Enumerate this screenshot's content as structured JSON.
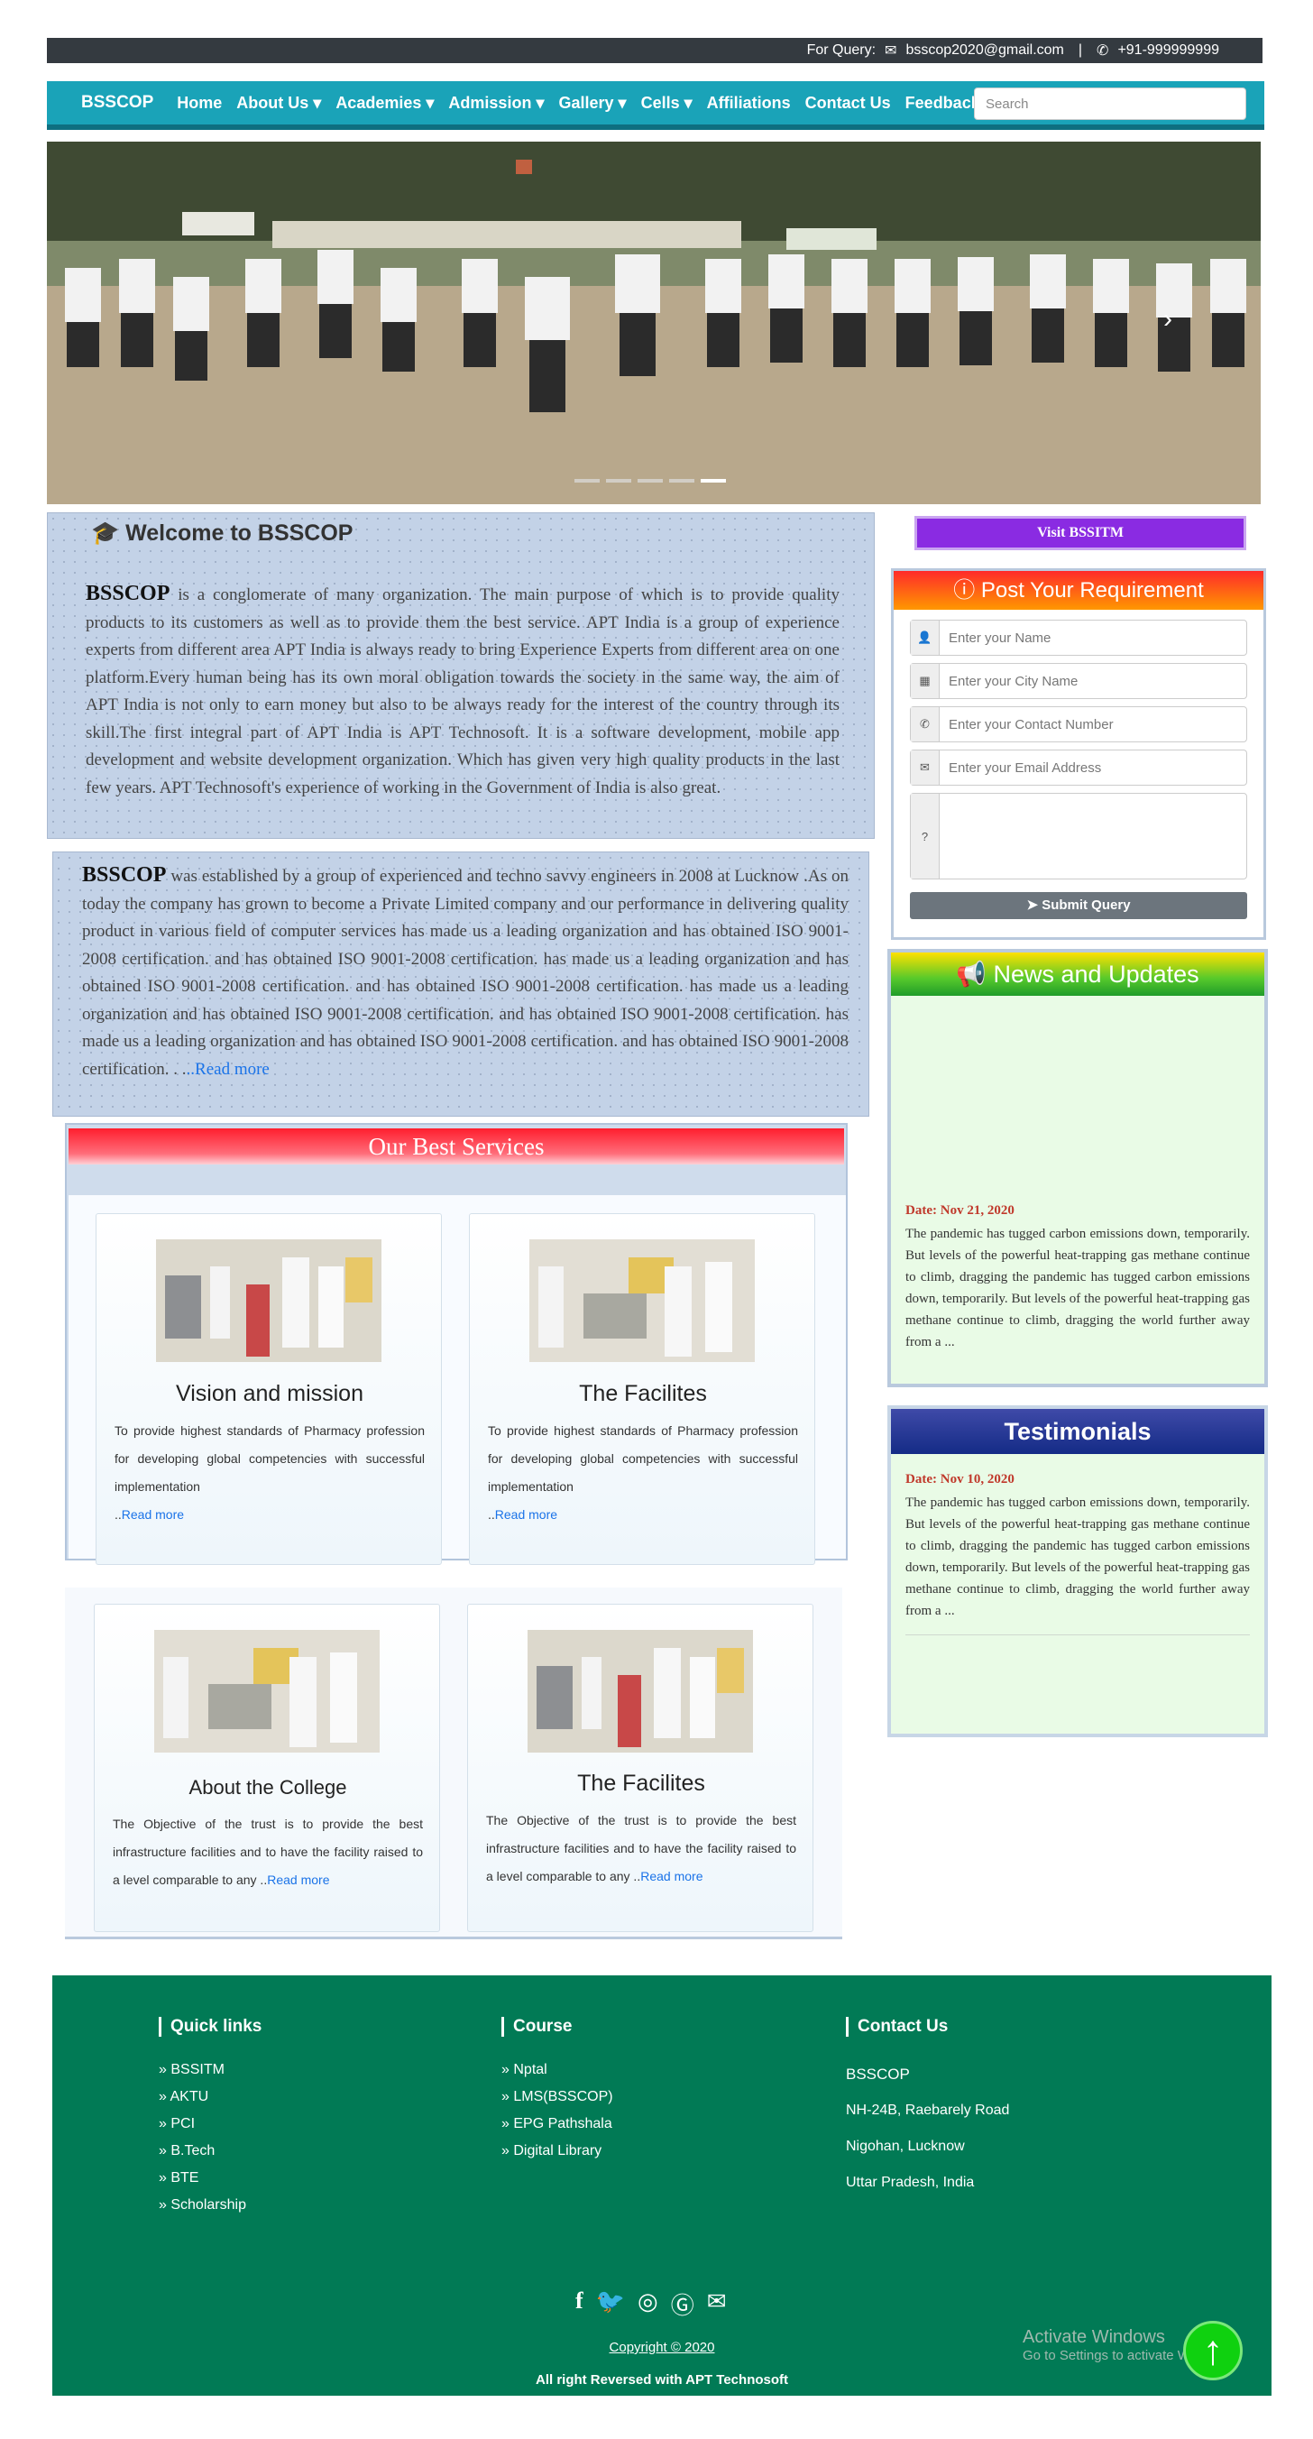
{
  "topbar": {
    "query_label": "For Query:",
    "email": "bsscop2020@gmail.com",
    "separator": "|",
    "phone": "+91-999999999"
  },
  "nav": {
    "brand": "BSSCOP",
    "items": [
      "Home",
      "About Us",
      "Academies",
      "Admission",
      "Gallery",
      "Cells",
      "Affiliations",
      "Contact Us",
      "Feedback"
    ],
    "dropdown_items": [
      "About Us",
      "Academies",
      "Admission",
      "Gallery",
      "Cells"
    ],
    "search_placeholder": "Search"
  },
  "slider": {
    "slide_count": 5,
    "active_slide": 5
  },
  "welcome": {
    "title": "Welcome to BSSCOP",
    "lead": "BSSCOP",
    "body": "is a conglomerate of many organization. The main purpose of which is to provide quality products to its customers as well as to provide them the best service. APT India is a group of experience experts from different area APT India is always ready to bring Experience Experts from different area on one platform.Every human being has its own moral obligation towards the society in the same way, the aim of APT India is not only to earn money but also to be always ready for the interest of the country through its skill.The first integral part of APT India is APT Technosoft. It is a software development, mobile app development and website development organization. Which has given very high quality products in the last few years. APT Technosoft's experience of working in the Government of India is also great."
  },
  "established": {
    "lead": "BSSCOP",
    "body": "was established by a group of experienced and techno savvy engineers in 2008 at Lucknow .As on today the company has grown to become a Private Limited company and our performance in delivering quality product in various field of computer services has made us a leading organization and has obtained ISO 9001-2008 certification. and has obtained ISO 9001-2008 certification. has made us a leading organization and has obtained ISO 9001-2008 certification. and has obtained ISO 9001-2008 certification. has made us a leading organization and has obtained ISO 9001-2008 certification. and has obtained ISO 9001-2008 certification. has made us a leading organization and has obtained ISO 9001-2008 certification. and has obtained ISO 9001-2008 certification. . .",
    "read_more": "..Read more"
  },
  "services": {
    "title": "Our Best Services",
    "cards": [
      {
        "title": "Vision and mission",
        "text": "To provide highest standards of Pharmacy profession for developing global competencies with successful implementation",
        "prefix": "..",
        "link": "Read more"
      },
      {
        "title": "The Facilites",
        "text": "To provide highest standards of Pharmacy profession for developing global competencies with successful implementation",
        "prefix": "..",
        "link": "Read more"
      },
      {
        "title": "About the College",
        "text": "The Objective of the trust is to provide the best infrastructure facilities and to have the facility raised to a level comparable to any ..",
        "link": "Read more"
      },
      {
        "title": "The Facilites",
        "text": "The Objective of the trust is to provide the best infrastructure facilities and to have the facility raised to a level comparable to any ..",
        "link": "Read more"
      }
    ]
  },
  "sidebar": {
    "visit_button": "Visit BSSITM",
    "requirement": {
      "title": "Post Your Requirement",
      "name_placeholder": "Enter your Name",
      "city_placeholder": "Enter your City Name",
      "contact_placeholder": "Enter your Contact Number",
      "email_placeholder": "Enter your Email Address",
      "submit": "Submit Query"
    },
    "news": {
      "title": "News and Updates",
      "date": "Date: Nov 21, 2020",
      "text": "The pandemic has tugged carbon emissions down, temporarily. But levels of the powerful heat-trapping gas methane continue to climb, dragging the pandemic has tugged carbon emissions down, temporarily. But levels of the powerful heat-trapping gas methane continue to climb, dragging the world further away from a ..."
    },
    "testimonials": {
      "title": "Testimonials",
      "date": "Date: Nov 10, 2020",
      "text": "The pandemic has tugged carbon emissions down, temporarily. But levels of the powerful heat-trapping gas methane continue to climb, dragging the pandemic has tugged carbon emissions down, temporarily. But levels of the powerful heat-trapping gas methane continue to climb, dragging the world further away from a ..."
    }
  },
  "footer": {
    "quick_links": {
      "title": "Quick links",
      "items": [
        "BSSITM",
        "AKTU",
        "PCI",
        "B.Tech",
        "BTE",
        "Scholarship"
      ]
    },
    "course": {
      "title": "Course",
      "items": [
        "Nptal",
        "LMS(BSSCOP)",
        "EPG Pathshala",
        "Digital Library"
      ]
    },
    "contact": {
      "title": "Contact Us",
      "lines": [
        "BSSCOP",
        "NH-24B, Raebarely Road",
        "Nigohan, Lucknow",
        "Uttar Pradesh, India"
      ]
    },
    "copyright": "Copyright © 2020",
    "reserved": "All right Reversed with  APT Technosoft"
  },
  "overlay": {
    "activate_title": "Activate Windows",
    "activate_sub": "Go to Settings to activate W"
  },
  "colors": {
    "nav": "#1aa3b8",
    "footer": "#017a55",
    "visit": "#8a2be2"
  }
}
